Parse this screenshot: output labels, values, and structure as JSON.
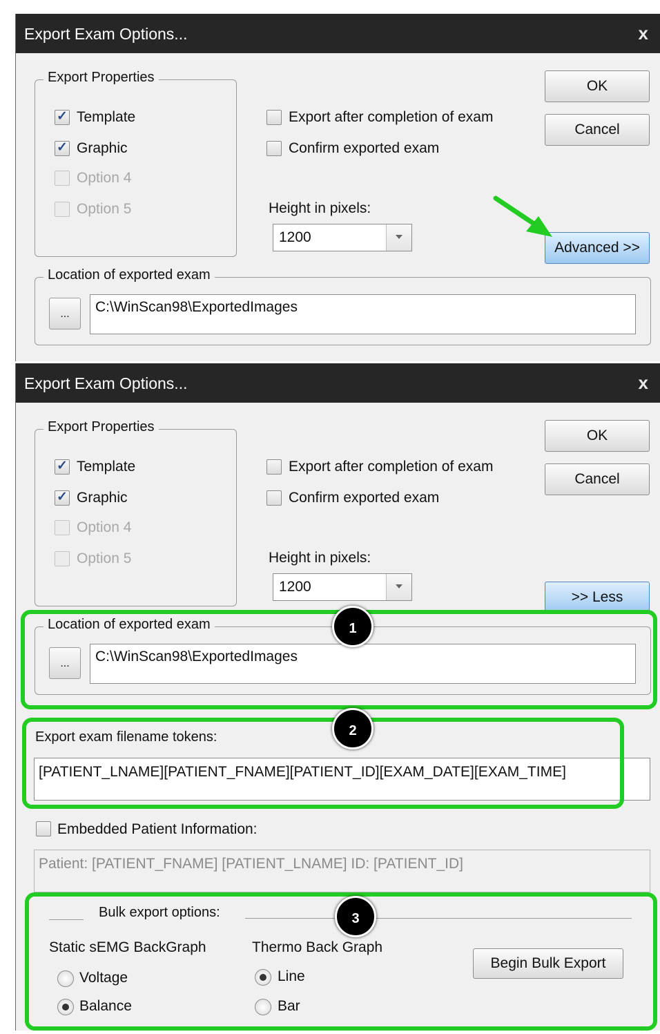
{
  "dialog1": {
    "title": "Export Exam Options...",
    "close": "x",
    "export_properties_legend": "Export Properties",
    "checkboxes": [
      "Template",
      "Graphic",
      "Option 4",
      "Option 5"
    ],
    "export_after": "Export after completion of exam",
    "confirm_exported": "Confirm exported exam",
    "height_label": "Height in pixels:",
    "height_value": "1200",
    "ok": "OK",
    "cancel": "Cancel",
    "advanced": "Advanced >>",
    "location_legend": "Location of exported exam",
    "browse": "...",
    "location_value": "C:\\WinScan98\\ExportedImages"
  },
  "dialog2": {
    "title": "Export Exam Options...",
    "close": "x",
    "export_properties_legend": "Export Properties",
    "checkboxes": [
      "Template",
      "Graphic",
      "Option 4",
      "Option 5"
    ],
    "export_after": "Export after completion of exam",
    "confirm_exported": "Confirm exported exam",
    "height_label": "Height in pixels:",
    "height_value": "1200",
    "ok": "OK",
    "cancel": "Cancel",
    "less": ">> Less",
    "location_legend": "Location of exported exam",
    "browse": "...",
    "location_value": "C:\\WinScan98\\ExportedImages",
    "filename_tokens_label": "Export exam filename tokens:",
    "filename_tokens_value": "[PATIENT_LNAME][PATIENT_FNAME][PATIENT_ID][EXAM_DATE][EXAM_TIME]",
    "embedded_label": "Embedded Patient Information:",
    "embedded_value": "Patient: [PATIENT_FNAME] [PATIENT_LNAME] ID: [PATIENT_ID]",
    "bulk_legend": "Bulk export options:",
    "static_semg_label": "Static sEMG BackGraph",
    "voltage": "Voltage",
    "balance": "Balance",
    "thermo_label": "Thermo Back Graph",
    "line": "Line",
    "bar": "Bar",
    "begin_bulk": "Begin Bulk Export"
  },
  "annotations": {
    "badge1": "1",
    "badge2": "2",
    "badge3": "3",
    "highlight_color": "#22cc22",
    "arrow_color": "#22cc22"
  }
}
